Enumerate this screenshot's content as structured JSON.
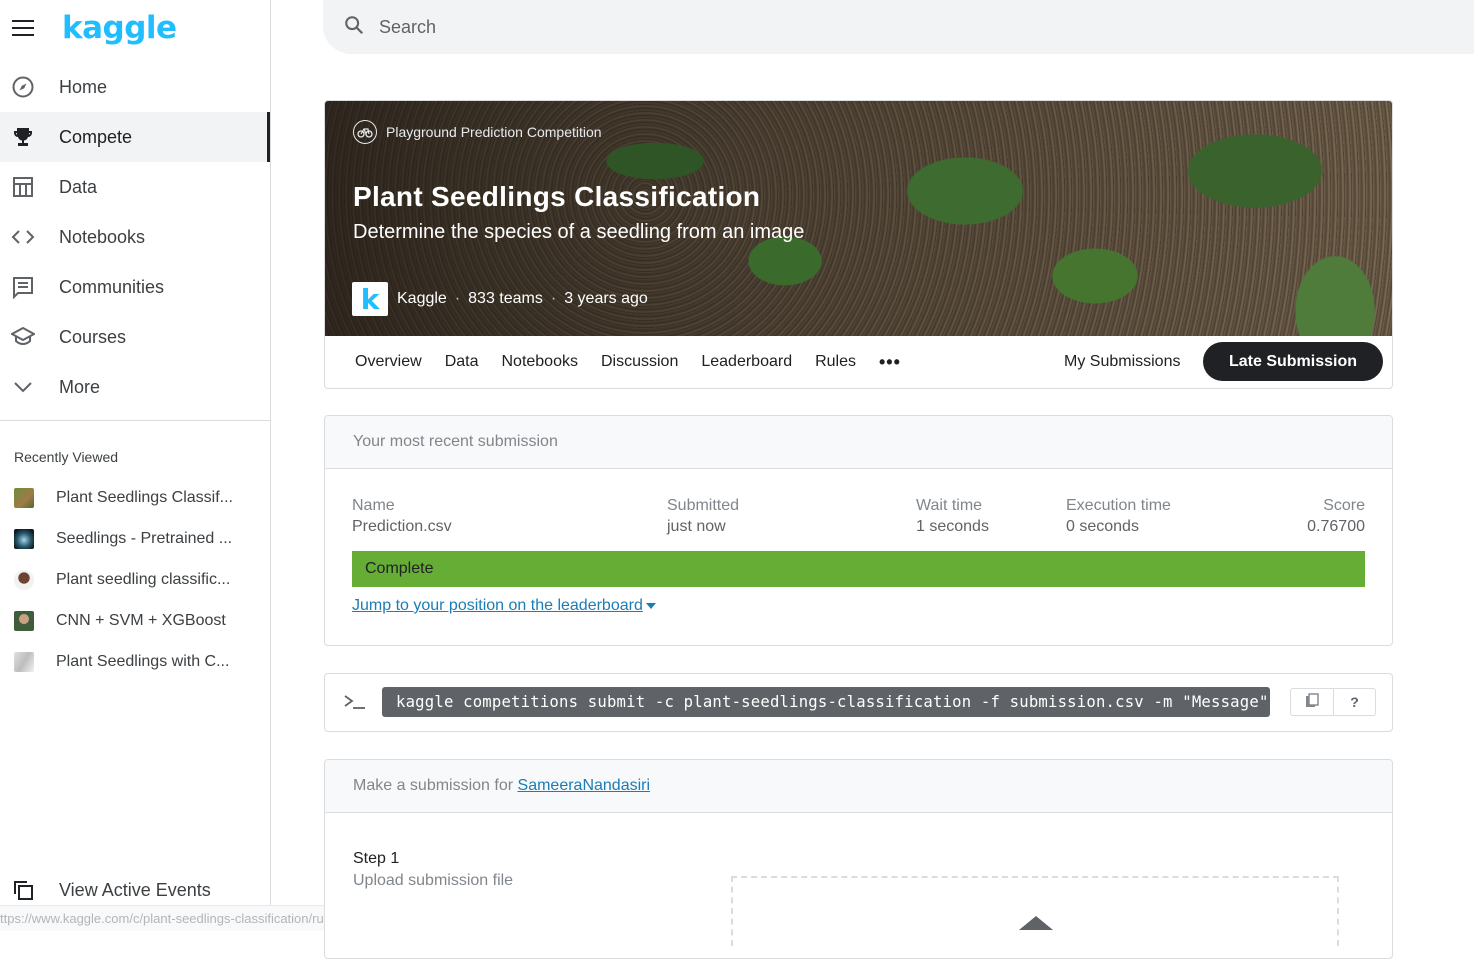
{
  "app": {
    "logo": "kaggle"
  },
  "sidebar": {
    "items": [
      {
        "label": "Home",
        "icon": "compass-icon"
      },
      {
        "label": "Compete",
        "icon": "trophy-icon",
        "active": true
      },
      {
        "label": "Data",
        "icon": "table-icon"
      },
      {
        "label": "Notebooks",
        "icon": "code-icon"
      },
      {
        "label": "Communities",
        "icon": "comment-icon"
      },
      {
        "label": "Courses",
        "icon": "school-icon"
      },
      {
        "label": "More",
        "icon": "chevron-down-icon"
      }
    ],
    "recently_viewed_title": "Recently Viewed",
    "recently_viewed": [
      {
        "label": "Plant Seedlings Classif..."
      },
      {
        "label": "Seedlings - Pretrained ..."
      },
      {
        "label": "Plant seedling classific..."
      },
      {
        "label": "CNN + SVM + XGBoost"
      },
      {
        "label": "Plant Seedlings with C..."
      }
    ],
    "view_events": "View Active Events"
  },
  "status_url": "ttps://www.kaggle.com/c/plant-seedlings-classification/rules",
  "search": {
    "placeholder": "Search"
  },
  "competition": {
    "tag": "Playground Prediction Competition",
    "title": "Plant Seedlings Classification",
    "subtitle": "Determine the species of a seedling from an image",
    "host": "Kaggle",
    "host_logo_letter": "k",
    "teams": "833 teams",
    "age": "3 years ago",
    "tabs": [
      "Overview",
      "Data",
      "Notebooks",
      "Discussion",
      "Leaderboard",
      "Rules"
    ],
    "more": "•••",
    "my_submissions": "My Submissions",
    "late_submission": "Late Submission"
  },
  "recent_submission": {
    "header": "Your most recent submission",
    "name_label": "Name",
    "name_value": "Prediction.csv",
    "submitted_label": "Submitted",
    "submitted_value": "just now",
    "wait_label": "Wait time",
    "wait_value": "1 seconds",
    "exec_label": "Execution time",
    "exec_value": "0 seconds",
    "score_label": "Score",
    "score_value": "0.76700",
    "status": "Complete",
    "status_color": "#66ad36",
    "jump_link": "Jump to your position on the leaderboard"
  },
  "cli": {
    "prompt": ">_",
    "command": "kaggle competitions submit -c plant-seedlings-classification -f submission.csv -m \"Message\"",
    "copy_icon": "clipboard-icon",
    "help": "?"
  },
  "make_submission": {
    "header_prefix": "Make a submission for ",
    "user": "SameeraNandasiri",
    "step_title": "Step 1",
    "step_subtitle": "Upload submission file"
  }
}
